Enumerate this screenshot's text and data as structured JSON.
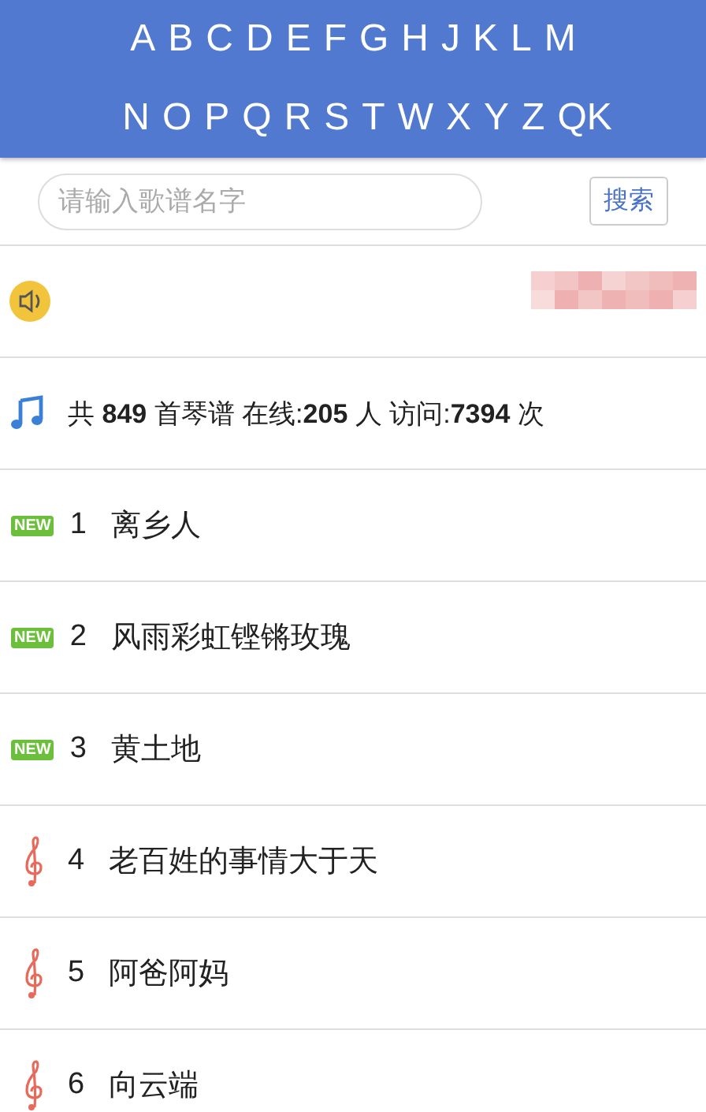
{
  "letters": [
    [
      "A",
      "B",
      "C",
      "D",
      "E",
      "F",
      "G",
      "H",
      "J",
      "K",
      "L",
      "M"
    ],
    [
      "N",
      "O",
      "P",
      "Q",
      "R",
      "S",
      "T",
      "W",
      "X",
      "Y",
      "Z",
      "QK"
    ]
  ],
  "search": {
    "placeholder": "请输入歌谱名字",
    "button": "搜索"
  },
  "stats": "共 **849** 首琴谱 在线:**205** 人 访问:**7394** 次",
  "songs": [
    {
      "kind": "new",
      "badge": "NEW",
      "number": "1",
      "title": "离乡人"
    },
    {
      "kind": "new",
      "badge": "NEW",
      "number": "2",
      "title": "风雨彩虹铿锵玫瑰"
    },
    {
      "kind": "new",
      "badge": "NEW",
      "number": "3",
      "title": "黄土地"
    },
    {
      "kind": "clef",
      "number": "4",
      "title": "老百姓的事情大于天"
    },
    {
      "kind": "clef",
      "number": "5",
      "title": "阿爸阿妈"
    },
    {
      "kind": "clef",
      "number": "6",
      "title": "向云端"
    }
  ]
}
